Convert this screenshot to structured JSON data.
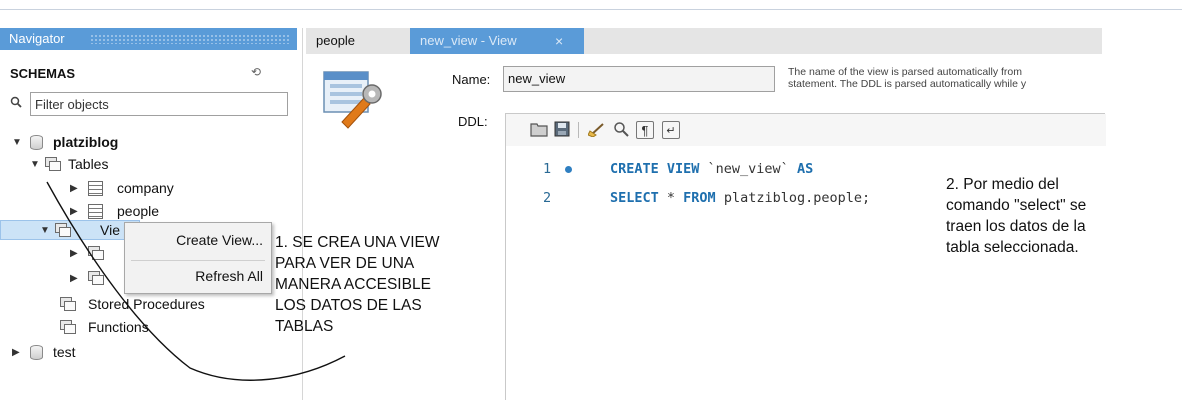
{
  "navigator": {
    "title": "Navigator",
    "schemas_label": "SCHEMAS",
    "filter_placeholder": "Filter objects",
    "tree": {
      "schema1": "platziblog",
      "tables": "Tables",
      "table1": "company",
      "table2": "people",
      "views": "Vie",
      "procedures": "Stored Procedures",
      "functions": "Functions",
      "schema2": "test"
    }
  },
  "context_menu": {
    "create_view": "Create View...",
    "refresh_all": "Refresh All"
  },
  "tabs": {
    "tab1": "people",
    "tab2": "new_view - View",
    "close_glyph": "×"
  },
  "editor": {
    "name_label": "Name:",
    "name_value": "new_view",
    "ddl_label": "DDL:",
    "hint_line1": "The name of the view is parsed automatically from",
    "hint_line2": "statement. The DDL is parsed automatically while y",
    "code": {
      "line1_no": "1",
      "line2_no": "2",
      "line1_kw": "CREATE VIEW",
      "line1_name": " `new_view` ",
      "line1_as": "AS",
      "line2_select": "SELECT",
      "line2_star": " * ",
      "line2_from": "FROM",
      "line2_rest": " platziblog.people;"
    }
  },
  "annotations": {
    "note1": [
      "1. SE CREA UNA VIEW",
      "PARA VER DE UNA",
      "MANERA ACCESIBLE",
      "LOS DATOS DE LAS",
      "TABLAS"
    ],
    "note2": [
      "2. Por medio del",
      "comando \"select\" se",
      "traen los datos de la",
      "tabla seleccionada."
    ]
  },
  "colors": {
    "navigator_header": "#5a9bd8",
    "keyword": "#1e6fae",
    "selection": "#cce3f7"
  }
}
